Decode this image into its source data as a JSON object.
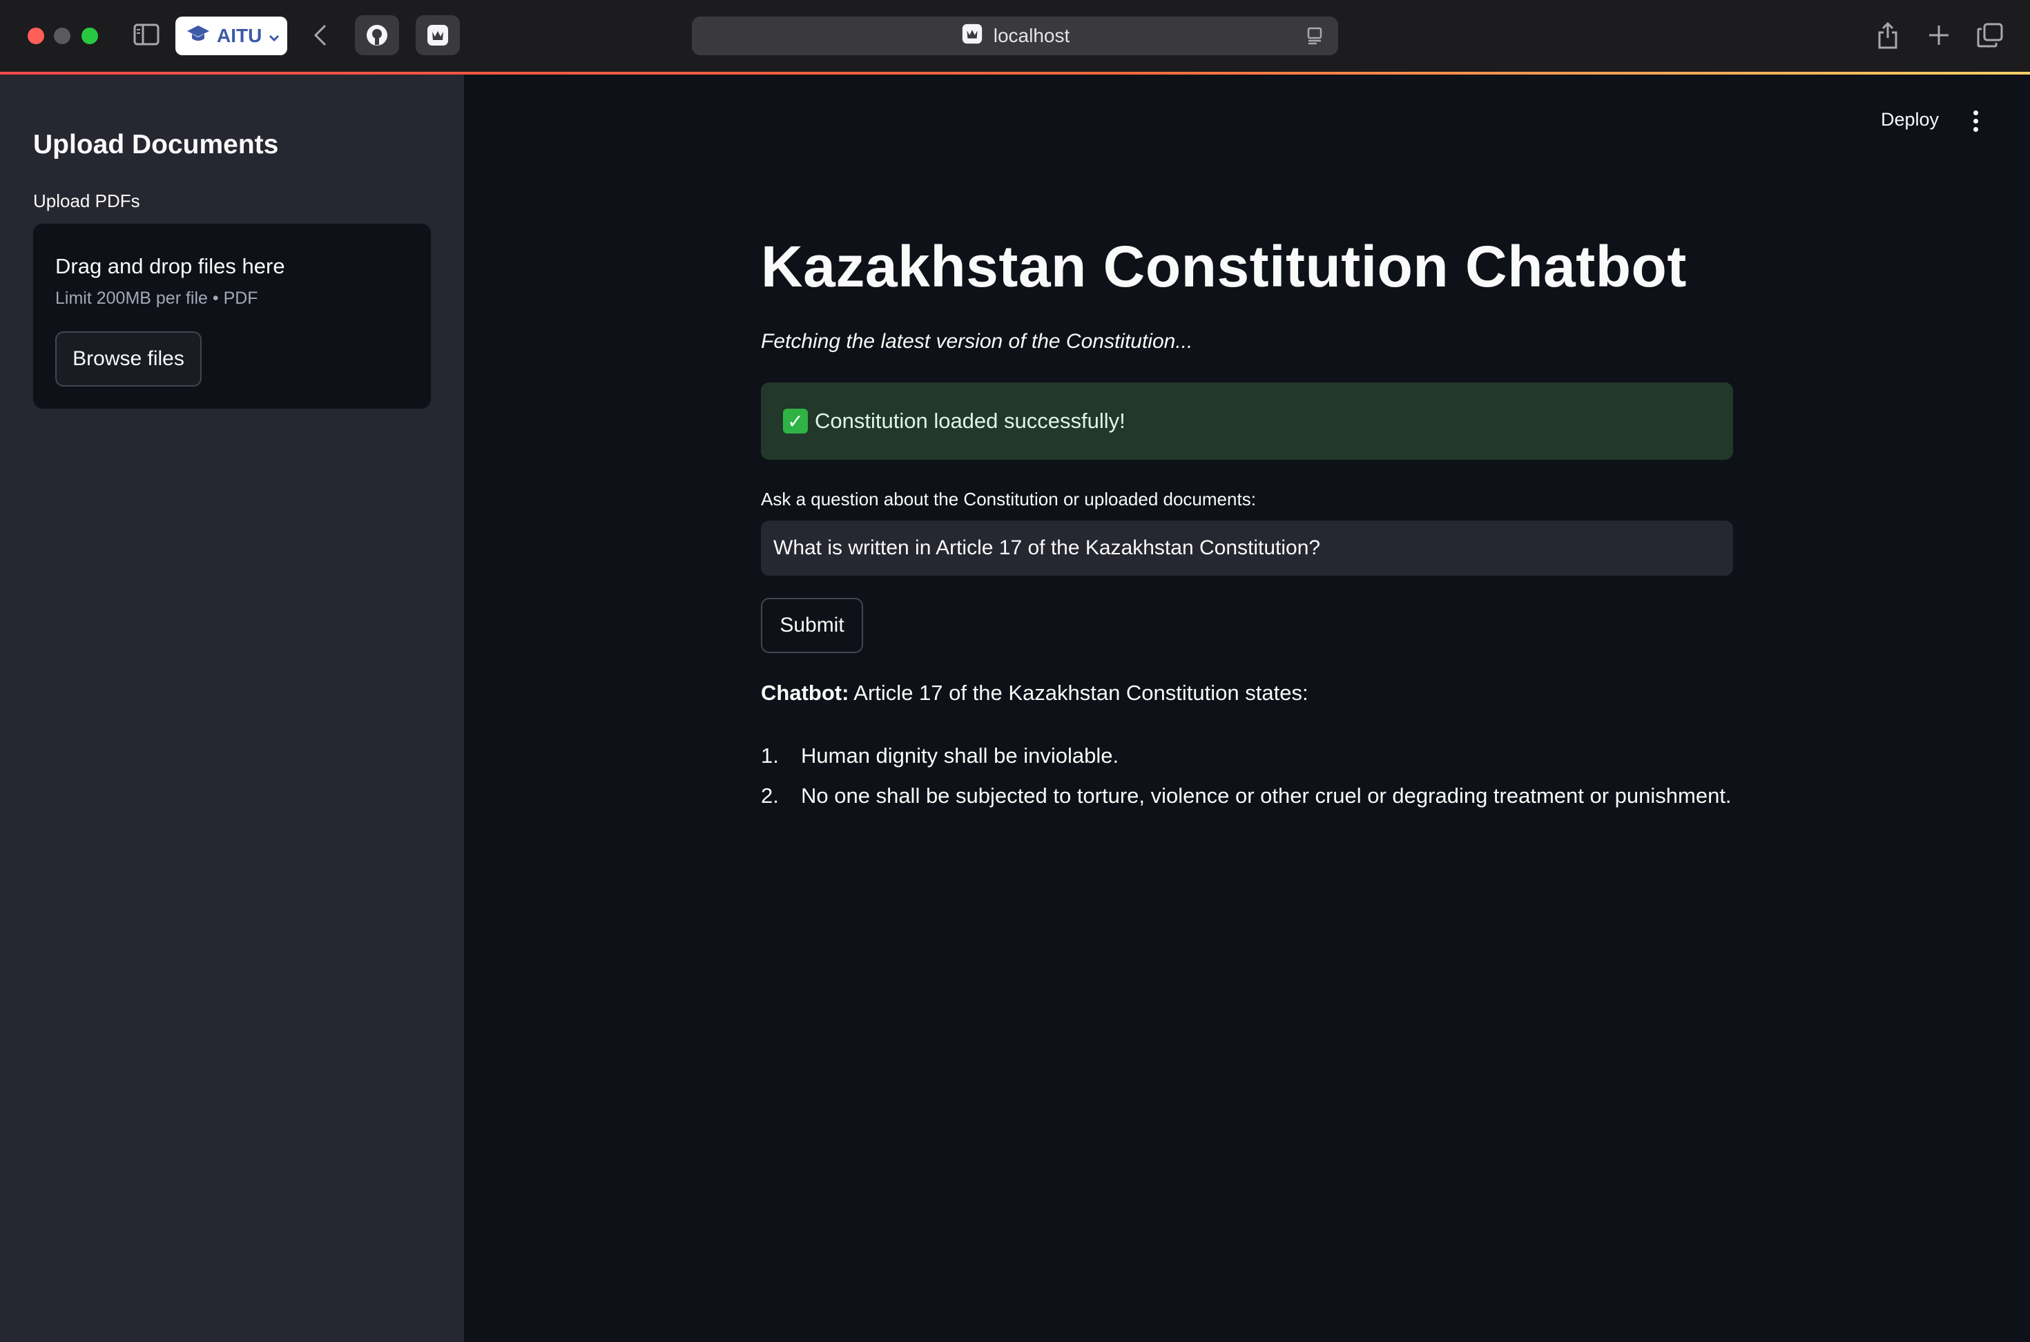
{
  "browser": {
    "profile_label": "AITU",
    "address": "localhost"
  },
  "sidebar": {
    "title": "Upload Documents",
    "upload_label": "Upload PDFs",
    "dropzone_title": "Drag and drop files here",
    "dropzone_limit": "Limit 200MB per file • PDF",
    "browse_label": "Browse files"
  },
  "header": {
    "deploy_label": "Deploy"
  },
  "main": {
    "title": "Kazakhstan Constitution Chatbot",
    "status_text": "Fetching the latest version of the Constitution...",
    "success_message": "Constitution loaded successfully!",
    "question_label": "Ask a question about the Constitution or uploaded documents:",
    "question_value": "What is written in Article 17 of the Kazakhstan Constitution?",
    "submit_label": "Submit",
    "answer_speaker": "Chatbot:",
    "answer_intro": " Article 17 of the Kazakhstan Constitution states:",
    "answer_items": [
      {
        "num": "1.",
        "text": "Human dignity shall be inviolable."
      },
      {
        "num": "2.",
        "text": "No one shall be subjected to torture, violence or other cruel or degrading treatment or punishment."
      }
    ]
  },
  "colors": {
    "background": "#0e1117",
    "sidebar": "#262730",
    "success_bg": "#21382b",
    "accent": "#ff4b4b"
  },
  "icons": [
    "sidebar-toggle-icon",
    "graduation-cap-icon",
    "chevron-down-icon",
    "back-icon",
    "github-icon",
    "streamlit-icon",
    "reader-icon",
    "share-icon",
    "plus-icon",
    "tabs-icon",
    "more-vertical-icon",
    "check-icon"
  ]
}
